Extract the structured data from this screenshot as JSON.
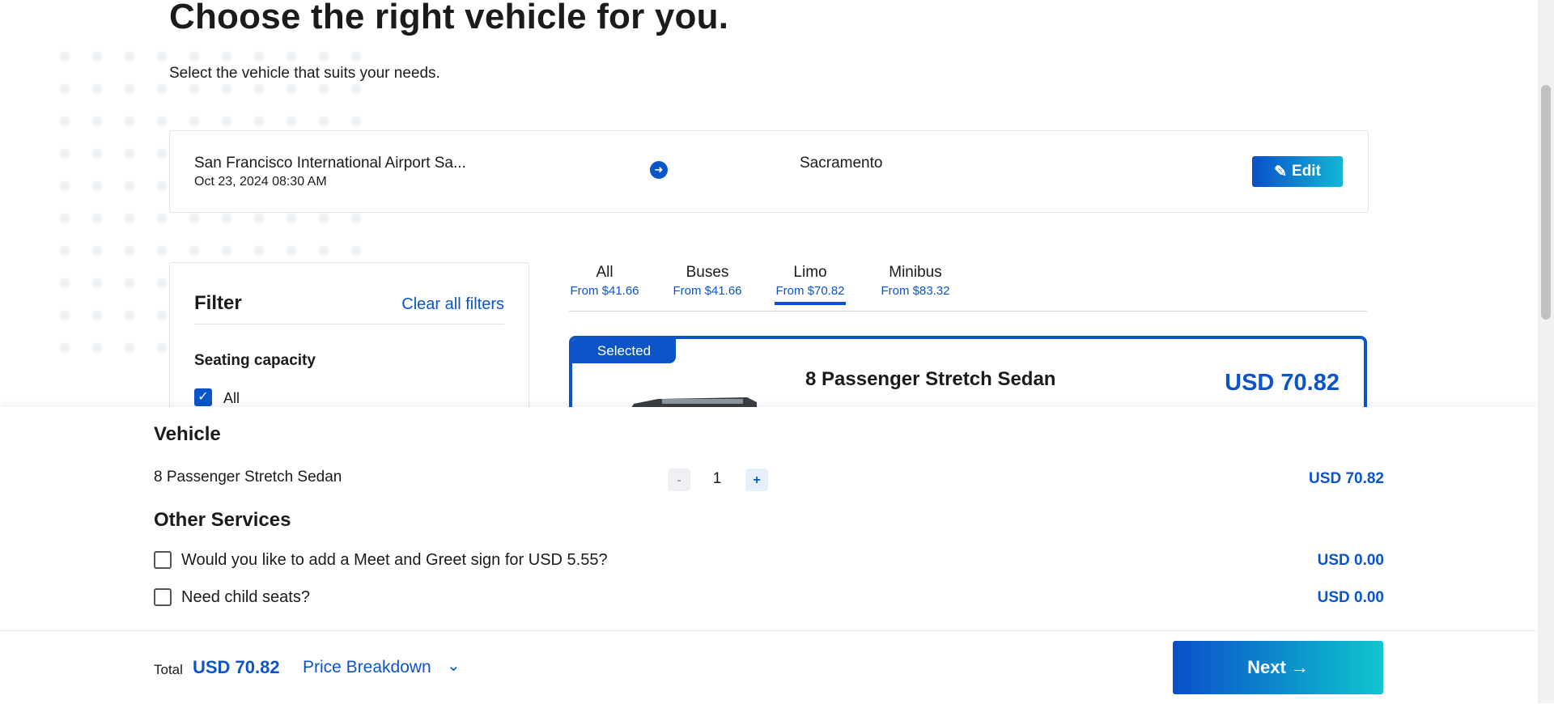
{
  "page": {
    "title": "Choose the right vehicle for you.",
    "subtitle": "Select the vehicle that suits your needs."
  },
  "route": {
    "from": "San Francisco International Airport Sa...",
    "date": "Oct 23, 2024 08:30 AM",
    "to": "Sacramento",
    "edit_label": "Edit"
  },
  "filter": {
    "title": "Filter",
    "clear_label": "Clear all filters",
    "seating_title": "Seating capacity",
    "all_label": "All"
  },
  "tabs": [
    {
      "name": "All",
      "price": "From $41.66"
    },
    {
      "name": "Buses",
      "price": "From $41.66"
    },
    {
      "name": "Limo",
      "price": "From $70.82"
    },
    {
      "name": "Minibus",
      "price": "From $83.32"
    }
  ],
  "active_tab": "Limo",
  "card": {
    "badge": "Selected",
    "name": "8 Passenger Stretch Sedan",
    "price": "USD 70.82"
  },
  "summary": {
    "vehicle_heading": "Vehicle",
    "vehicle_name": "8 Passenger Stretch Sedan",
    "minus": "-",
    "qty": "1",
    "plus": "+",
    "vehicle_amount": "USD 70.82",
    "other_heading": "Other Services",
    "service1_label": "Would you like to add a Meet and Greet sign for USD 5.55?",
    "service1_amount": "USD 0.00",
    "service2_label": "Need child seats?",
    "service2_amount": "USD 0.00"
  },
  "footer": {
    "total_label": "Total",
    "total_value": "USD 70.82",
    "breakdown_label": "Price Breakdown",
    "next_label": "Next →"
  },
  "colors": {
    "accent": "#0b55c9",
    "gradient_end": "#12c4d2"
  }
}
